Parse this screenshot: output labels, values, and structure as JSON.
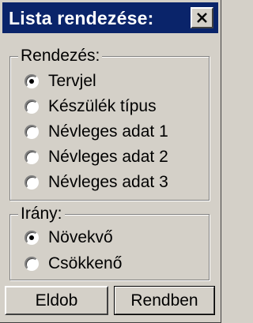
{
  "window": {
    "title": "Lista rendezése:",
    "close_icon": "close-icon"
  },
  "sort_group": {
    "legend": "Rendezés:",
    "options": [
      {
        "label": "Tervjel",
        "checked": true
      },
      {
        "label": "Készülék típus",
        "checked": false
      },
      {
        "label": "Névleges adat 1",
        "checked": false
      },
      {
        "label": "Névleges adat 2",
        "checked": false
      },
      {
        "label": "Névleges adat 3",
        "checked": false
      }
    ]
  },
  "direction_group": {
    "legend": "Irány:",
    "options": [
      {
        "label": "Növekvő",
        "checked": true
      },
      {
        "label": "Csökkenő",
        "checked": false
      }
    ]
  },
  "buttons": {
    "discard_label": "Eldob",
    "ok_label": "Rendben"
  }
}
